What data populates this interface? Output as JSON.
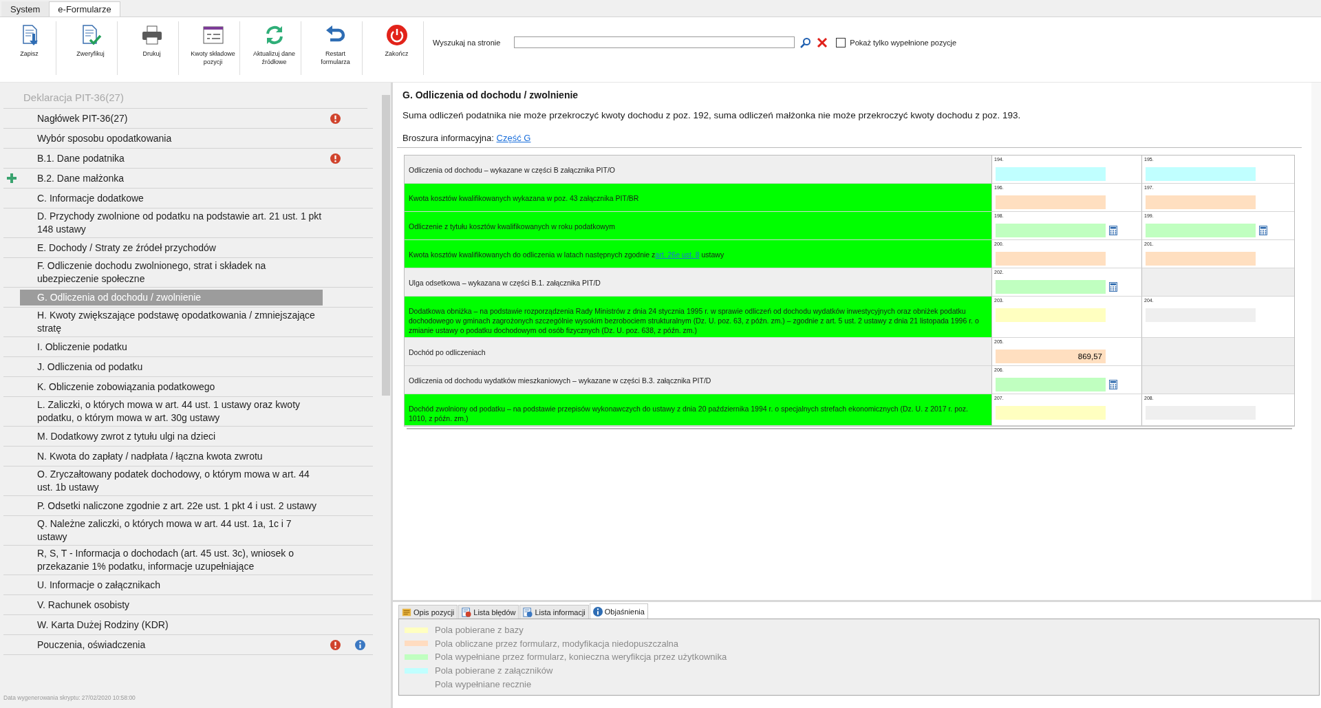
{
  "menu_tabs": [
    {
      "label": "System",
      "selected": false
    },
    {
      "label": "e-Formularze",
      "selected": true
    }
  ],
  "toolbar": [
    {
      "kind": "save",
      "label": "Zapisz"
    },
    {
      "kind": "verify",
      "label": "Zweryfikuj"
    },
    {
      "kind": "print",
      "label": "Drukuj"
    },
    {
      "kind": "amounts",
      "label": "Kwoty składowe pozycji"
    },
    {
      "kind": "refresh",
      "label": "Aktualizuj dane źródłowe"
    },
    {
      "kind": "restart",
      "label": "Restart formularza"
    },
    {
      "kind": "exit",
      "label": "Zakończ"
    }
  ],
  "search": {
    "label": "Wyszukaj na stronie",
    "filled_only": {
      "label": "Pokaż tylko wypełnione pozycje",
      "checked": false
    }
  },
  "sidebar": {
    "title": "Deklaracja PIT-36(27)",
    "items": [
      {
        "label": "Nagłówek PIT-36(27)",
        "selected": false,
        "error": true,
        "info": false,
        "added": false
      },
      {
        "label": "Wybór sposobu opodatkowania",
        "selected": false,
        "error": false,
        "info": false,
        "added": false
      },
      {
        "label": "B.1. Dane podatnika",
        "selected": false,
        "error": true,
        "info": false,
        "added": false
      },
      {
        "label": "B.2. Dane małżonka",
        "selected": false,
        "error": false,
        "info": false,
        "added": true
      },
      {
        "label": "C. Informacje dodatkowe",
        "selected": false,
        "error": false,
        "info": false,
        "added": false
      },
      {
        "label": "D. Przychody zwolnione od podatku na podstawie art. 21 ust. 1 pkt 148 ustawy",
        "selected": false,
        "error": false,
        "info": false,
        "added": false
      },
      {
        "label": "E. Dochody / Straty ze źródeł przychodów",
        "selected": false,
        "error": false,
        "info": false,
        "added": false
      },
      {
        "label": "F. Odliczenie dochodu zwolnionego, strat i składek na ubezpieczenie społeczne",
        "selected": false,
        "error": false,
        "info": false,
        "added": false
      },
      {
        "label": "G. Odliczenia od dochodu / zwolnienie",
        "selected": true,
        "error": false,
        "info": false,
        "added": false
      },
      {
        "label": "H. Kwoty zwiększające podstawę opodatkowania / zmniejszające stratę",
        "selected": false,
        "error": false,
        "info": false,
        "added": false
      },
      {
        "label": "I. Obliczenie podatku",
        "selected": false,
        "error": false,
        "info": false,
        "added": false
      },
      {
        "label": "J. Odliczenia od podatku",
        "selected": false,
        "error": false,
        "info": false,
        "added": false
      },
      {
        "label": "K. Obliczenie zobowiązania podatkowego",
        "selected": false,
        "error": false,
        "info": false,
        "added": false
      },
      {
        "label": "L. Zaliczki, o których mowa w art. 44 ust. 1 ustawy oraz kwoty podatku, o którym mowa w art. 30g ustawy",
        "selected": false,
        "error": false,
        "info": false,
        "added": false
      },
      {
        "label": "M. Dodatkowy zwrot z tytułu ulgi na dzieci",
        "selected": false,
        "error": false,
        "info": false,
        "added": false
      },
      {
        "label": "N. Kwota do zapłaty / nadpłata / łączna kwota zwrotu",
        "selected": false,
        "error": false,
        "info": false,
        "added": false
      },
      {
        "label": "O. Zryczałtowany podatek dochodowy, o którym mowa w art. 44 ust. 1b ustawy",
        "selected": false,
        "error": false,
        "info": false,
        "added": false
      },
      {
        "label": "P. Odsetki naliczone zgodnie z art. 22e ust. 1 pkt 4 i ust. 2 ustawy",
        "selected": false,
        "error": false,
        "info": false,
        "added": false
      },
      {
        "label": "Q. Należne zaliczki, o których mowa w art. 44 ust. 1a, 1c i 7 ustawy",
        "selected": false,
        "error": false,
        "info": false,
        "added": false
      },
      {
        "label": "R, S, T - Informacja o dochodach (art. 45 ust. 3c), wniosek o przekazanie 1% podatku, informacje uzupełniające",
        "selected": false,
        "error": false,
        "info": false,
        "added": false
      },
      {
        "label": "U. Informacje o załącznikach",
        "selected": false,
        "error": false,
        "info": false,
        "added": false
      },
      {
        "label": "V. Rachunek osobisty",
        "selected": false,
        "error": false,
        "info": false,
        "added": false
      },
      {
        "label": "W. Karta Dużej Rodziny (KDR)",
        "selected": false,
        "error": false,
        "info": false,
        "added": false
      },
      {
        "label": "Pouczenia, oświadczenia",
        "selected": false,
        "error": true,
        "info": true,
        "added": false
      }
    ],
    "footer": "Data wygenerowania skryptu: 27/02/2020 10:58:00"
  },
  "section": {
    "title": "G. Odliczenia od dochodu / zwolnienie",
    "note": "Suma odliczeń podatnika nie może przekroczyć kwoty dochodu z poz. 192, suma odliczeń małżonka nie może przekroczyć kwoty dochodu z poz. 193.",
    "brochure_label": "Broszura informacyjna:",
    "brochure_link": "Część G"
  },
  "rows": [
    {
      "label": "Odliczenia od dochodu – wykazane w części B załącznika PIT/O",
      "highlighted": false,
      "fields": [
        {
          "number": "194.",
          "kind": "attachment",
          "calculator": false
        },
        {
          "number": "195.",
          "kind": "attachment",
          "calculator": false
        }
      ]
    },
    {
      "label": "Kwota kosztów kwalifikowanych wykazana w poz. 43 załącznika PIT/BR",
      "highlighted": true,
      "fields": [
        {
          "number": "196.",
          "kind": "calculated",
          "calculator": false
        },
        {
          "number": "197.",
          "kind": "calculated",
          "calculator": false
        }
      ]
    },
    {
      "label": "Odliczenie z tytułu kosztów kwalifikowanych w roku podatkowym",
      "highlighted": true,
      "fields": [
        {
          "number": "198.",
          "kind": "verify",
          "calculator": true
        },
        {
          "number": "199.",
          "kind": "verify",
          "calculator": true
        }
      ]
    },
    {
      "label": "Kwota kosztów kwalifikowanych do odliczenia w latach następnych zgodnie z",
      "link": "art. 26e ust. 8",
      "label_after": "ustawy",
      "highlighted": true,
      "fields": [
        {
          "number": "200.",
          "kind": "calculated",
          "calculator": false
        },
        {
          "number": "201.",
          "kind": "calculated",
          "calculator": false
        }
      ]
    },
    {
      "label": "Ulga odsetkowa – wykazana w części B.1. załącznika PIT/D",
      "highlighted": false,
      "fields": [
        {
          "number": "202.",
          "kind": "verify",
          "calculator": true
        }
      ]
    },
    {
      "label": "Dodatkowa obniżka – na podstawie rozporządzenia Rady Ministrów z dnia 24 stycznia 1995 r. w sprawie odliczeń od dochodu wydatków inwestycyjnych oraz obniżek podatku dochodowego w gminach zagrożonych szczególnie wysokim bezrobociem strukturalnym (Dz. U. poz. 63, z późn. zm.) – zgodnie z art. 5 ust. 2 ustawy z dnia 21 listopada 1996 r. o zmianie ustawy o podatku dochodowym od osób fizycznych (Dz. U. poz. 638, z późn. zm.)",
      "highlighted": true,
      "fields": [
        {
          "number": "203.",
          "kind": "base",
          "calculator": false
        },
        {
          "number": "204.",
          "kind": "disabled",
          "calculator": false
        }
      ]
    },
    {
      "label": "Dochód po odliczeniach",
      "highlighted": false,
      "fields": [
        {
          "number": "205.",
          "kind": "calculated",
          "value": "869,57",
          "calculator": false
        }
      ]
    },
    {
      "label": "Odliczenia od dochodu wydatków mieszkaniowych – wykazane w części B.3. załącznika PIT/D",
      "highlighted": false,
      "fields": [
        {
          "number": "206.",
          "kind": "verify",
          "calculator": true
        }
      ]
    },
    {
      "label": "Dochód zwolniony od podatku – na podstawie przepisów wykonawczych do ustawy z dnia 20 października 1994 r. o specjalnych strefach ekonomicznych (Dz. U. z 2017 r. poz. 1010, z późn. zm.)",
      "highlighted": true,
      "fields": [
        {
          "number": "207.",
          "kind": "base",
          "calculator": false
        },
        {
          "number": "208.",
          "kind": "disabled",
          "calculator": false
        }
      ]
    }
  ],
  "bottom_tabs": [
    {
      "kind": "description",
      "label": "Opis pozycji",
      "selected": false
    },
    {
      "kind": "errors",
      "label": "Lista błędów",
      "selected": false
    },
    {
      "kind": "infolist",
      "label": "Lista informacji",
      "selected": false
    },
    {
      "kind": "info",
      "label": "Objaśnienia",
      "selected": true
    }
  ],
  "legend": [
    {
      "label": "Pola pobierane z bazy",
      "color": "#ffffc0"
    },
    {
      "label": "Pola obliczane przez formularz, modyfikacja niedopuszczalna",
      "color": "#ffdcc0"
    },
    {
      "label": "Pola wypełniane przez formularz, konieczna weryfikcja przez użytkownika",
      "color": "#c0ffc0"
    },
    {
      "label": "Pola pobierane z załączników",
      "color": "#c0ffff"
    },
    {
      "label": "Pola wypełniane recznie"
    }
  ]
}
